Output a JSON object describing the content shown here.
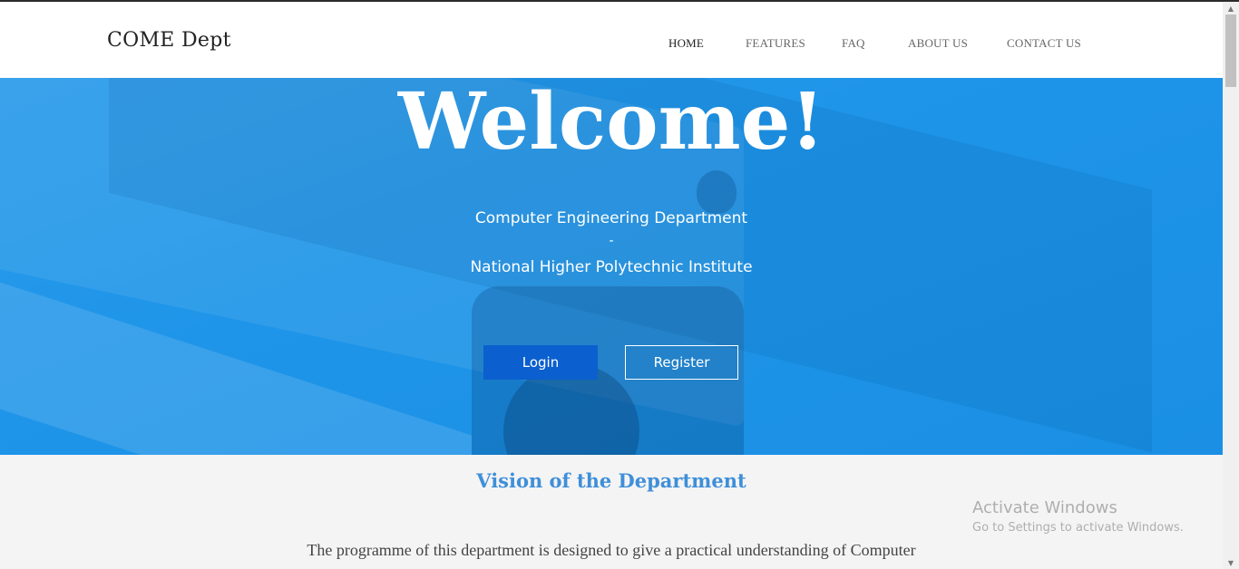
{
  "navbar": {
    "brand": "COME Dept",
    "items": [
      {
        "label": "HOME",
        "active": true
      },
      {
        "label": "FEATURES",
        "active": false
      },
      {
        "label": "FAQ",
        "active": false
      },
      {
        "label": "ABOUT US",
        "active": false
      },
      {
        "label": "CONTACT US",
        "active": false
      }
    ]
  },
  "hero": {
    "title": "Welcome!",
    "line1": "Computer Engineering Department",
    "separator": "-",
    "line2": "National Higher Polytechnic Institute",
    "login_label": "Login",
    "register_label": "Register",
    "background_color": "#1f95e9"
  },
  "vision": {
    "title": "Vision of the Department",
    "intro": "The programme of this department is designed to give a practical understanding of Computer"
  },
  "watermark": {
    "title": "Activate Windows",
    "subtitle": "Go to Settings to activate Windows."
  },
  "colors": {
    "login_button": "#0b5fcf",
    "vision_title": "#3f8fd9"
  }
}
